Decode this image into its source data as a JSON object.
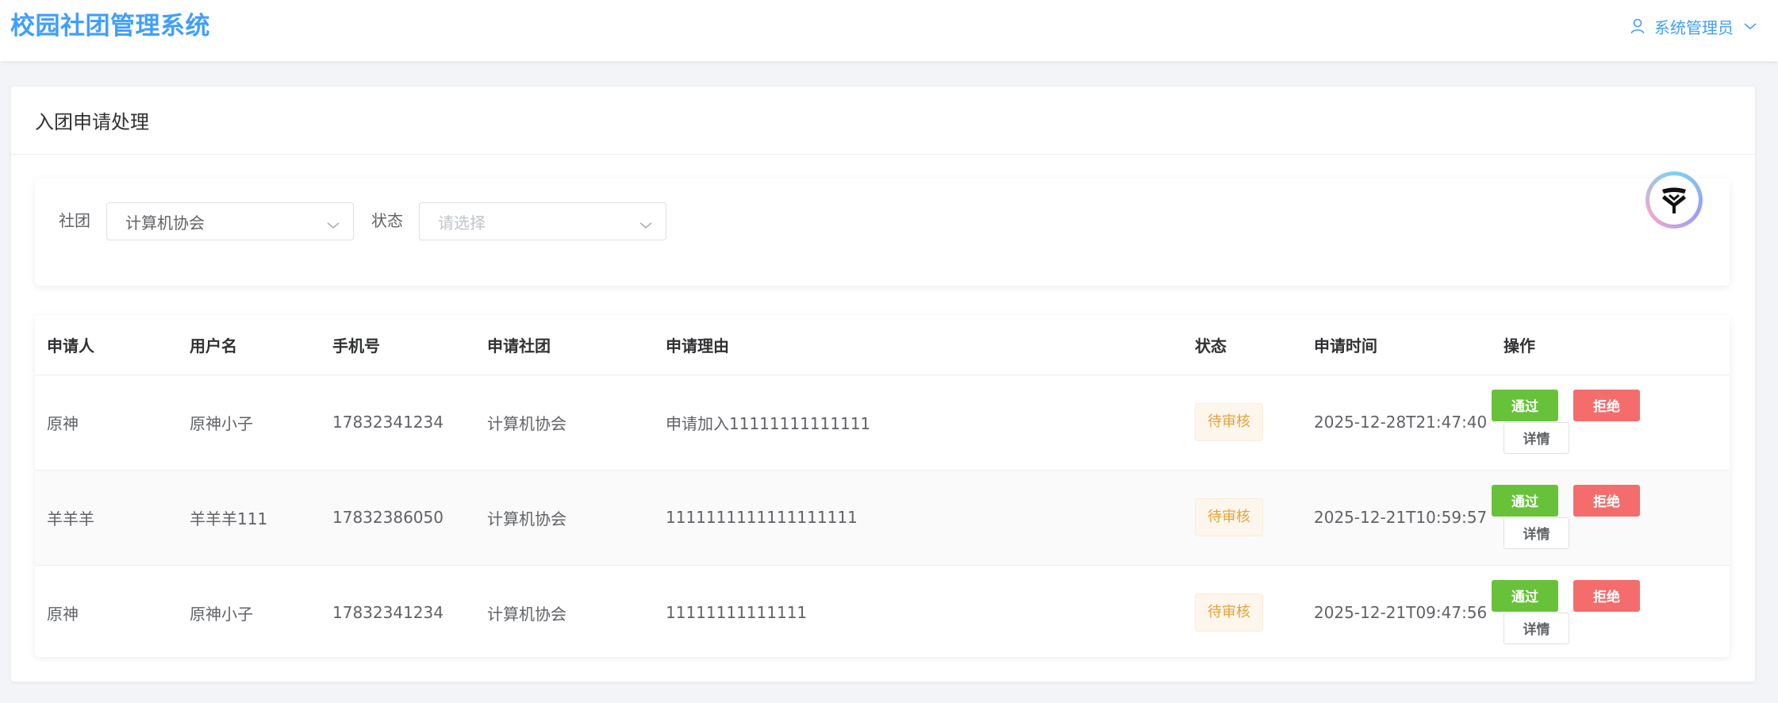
{
  "header": {
    "brand": "校园社团管理系统",
    "user": "系统管理员"
  },
  "page": {
    "title": "入团申请处理"
  },
  "filters": {
    "club_label": "社团",
    "club_value": "计算机协会",
    "status_label": "状态",
    "status_placeholder": "请选择"
  },
  "table": {
    "columns": [
      "申请人",
      "用户名",
      "手机号",
      "申请社团",
      "申请理由",
      "状态",
      "申请时间",
      "操作"
    ],
    "rows": [
      {
        "applicant": "原神",
        "username": "原神小子",
        "phone": "17832341234",
        "club": "计算机协会",
        "reason": "申请加入11111111111111",
        "status": "待审核",
        "time": "2025-12-28T21:47:40"
      },
      {
        "applicant": "羊羊羊",
        "username": "羊羊羊111",
        "phone": "17832386050",
        "club": "计算机协会",
        "reason": "1111111111111111111",
        "status": "待审核",
        "time": "2025-12-21T10:59:57"
      },
      {
        "applicant": "原神",
        "username": "原神小子",
        "phone": "17832341234",
        "club": "计算机协会",
        "reason": "11111111111111",
        "status": "待审核",
        "time": "2025-12-21T09:47:56"
      }
    ],
    "actions": {
      "pass": "通过",
      "reject": "拒绝",
      "detail": "详情"
    }
  },
  "colors": {
    "primary": "#409eff",
    "success": "#67c23a",
    "danger": "#f56c6c",
    "warning": "#e6a23c"
  },
  "icons": {
    "user": "user-icon",
    "dropdown": "chevron-down-icon",
    "floating_assistant": "assistant-logo-icon"
  }
}
